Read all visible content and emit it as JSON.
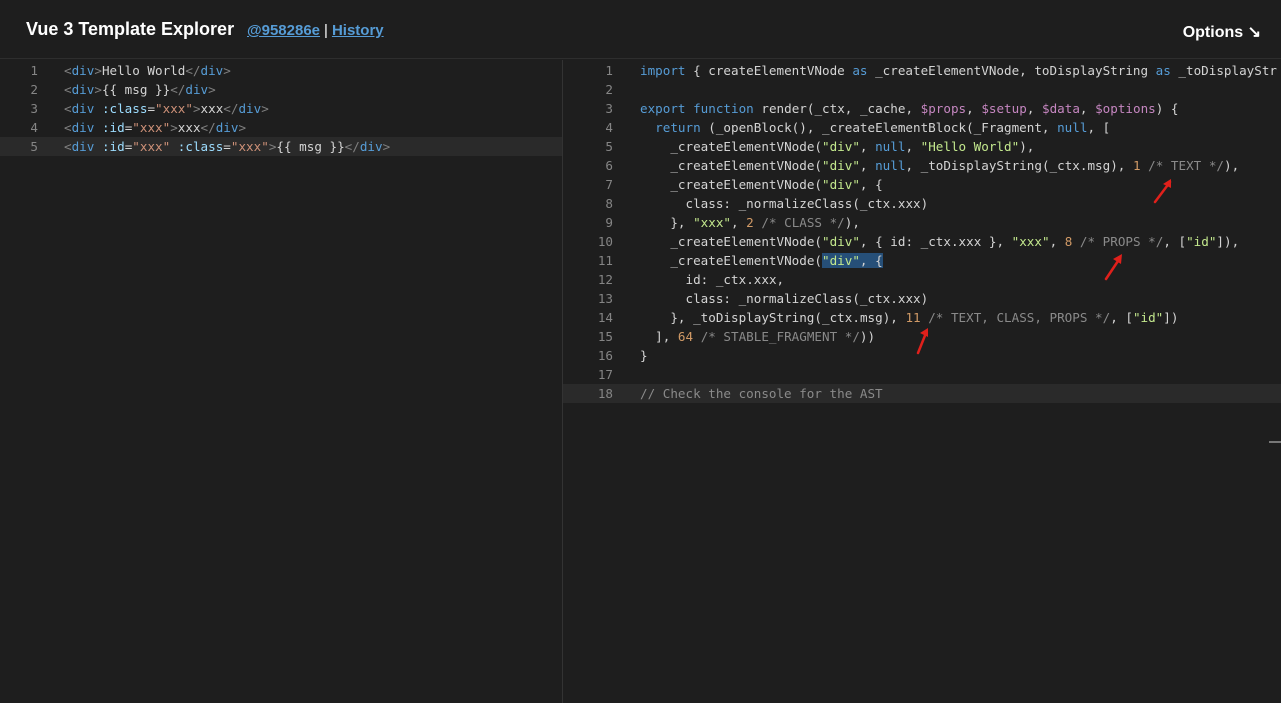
{
  "header": {
    "title": "Vue 3 Template Explorer",
    "commit_link": "@958286e",
    "separator": "|",
    "history_link": "History",
    "options_label": "Options ↘"
  },
  "left_editor": {
    "line_numbers": [
      "1",
      "2",
      "3",
      "4",
      "5"
    ],
    "lines": [
      "<div>Hello World</div>",
      "<div>{{ msg }}</div>",
      "<div :class=\"xxx\">xxx</div>",
      "<div :id=\"xxx\">xxx</div>",
      "<div :id=\"xxx\" :class=\"xxx\">{{ msg }}</div>"
    ]
  },
  "right_editor": {
    "line_numbers": [
      "1",
      "2",
      "3",
      "4",
      "5",
      "6",
      "7",
      "8",
      "9",
      "10",
      "11",
      "12",
      "13",
      "14",
      "15",
      "16",
      "17",
      "18"
    ],
    "lines": [
      "import { createElementVNode as _createElementVNode, toDisplayString as _toDisplayStr",
      "",
      "export function render(_ctx, _cache, $props, $setup, $data, $options) {",
      "  return (_openBlock(), _createElementBlock(_Fragment, null, [",
      "    _createElementVNode(\"div\", null, \"Hello World\"),",
      "    _createElementVNode(\"div\", null, _toDisplayString(_ctx.msg), 1 /* TEXT */),",
      "    _createElementVNode(\"div\", {",
      "      class: _normalizeClass(_ctx.xxx)",
      "    }, \"xxx\", 2 /* CLASS */),",
      "    _createElementVNode(\"div\", { id: _ctx.xxx }, \"xxx\", 8 /* PROPS */, [\"id\"]),",
      "    _createElementVNode(\"div\", {",
      "      id: _ctx.xxx,",
      "      class: _normalizeClass(_ctx.xxx)",
      "    }, _toDisplayString(_ctx.msg), 11 /* TEXT, CLASS, PROPS */, [\"id\"])",
      "  ], 64 /* STABLE_FRAGMENT */))",
      "}",
      "",
      "// Check the console for the AST"
    ]
  },
  "colors": {
    "background": "#1e1e1e",
    "keyword": "#569cd6",
    "string": "#ce9178",
    "number": "#d19a66",
    "comment": "#8a8a8a",
    "annotation_arrow": "#e0201b"
  }
}
